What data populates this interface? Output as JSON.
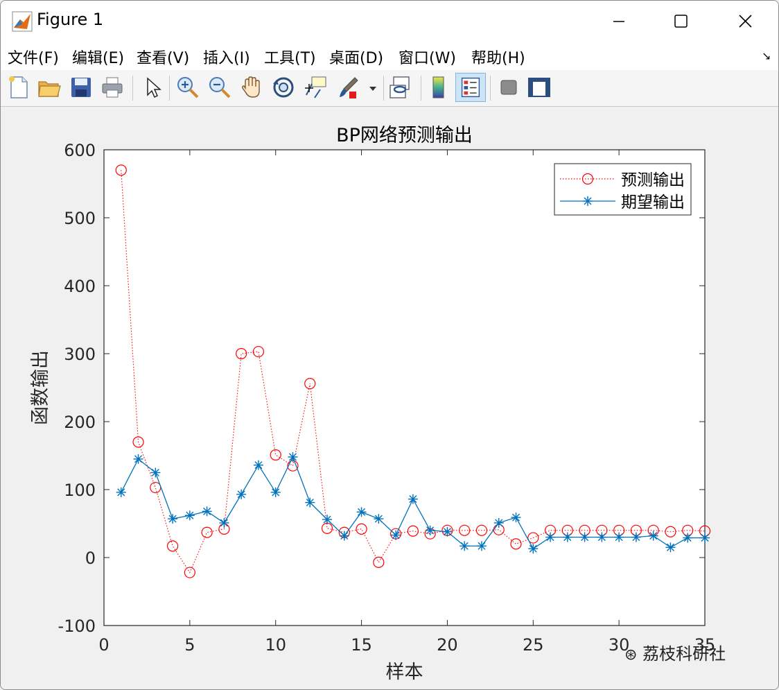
{
  "window": {
    "title": "Figure 1"
  },
  "menu": {
    "items": [
      "文件(F)",
      "编辑(E)",
      "查看(V)",
      "插入(I)",
      "工具(T)",
      "桌面(D)",
      "窗口(W)",
      "帮助(H)"
    ]
  },
  "toolbar": {
    "icons": [
      "new-figure-icon",
      "open-icon",
      "save-icon",
      "print-icon",
      "pointer-icon",
      "zoom-in-icon",
      "zoom-out-icon",
      "pan-hand-icon",
      "rotate-3d-icon",
      "data-cursor-icon",
      "brush-icon",
      "dropdown-arrow-icon",
      "link-plot-icon",
      "colorbar-icon",
      "legend-icon",
      "hide-plot-tools-icon",
      "show-plot-tools-icon"
    ]
  },
  "watermark": "荔枝科研社",
  "chart_data": {
    "type": "line",
    "title": "BP网络预测输出",
    "xlabel": "样本",
    "ylabel": "函数输出",
    "xlim": [
      0,
      35
    ],
    "ylim": [
      -100,
      600
    ],
    "xticks": [
      0,
      5,
      10,
      15,
      20,
      25,
      30,
      35
    ],
    "yticks": [
      -100,
      0,
      100,
      200,
      300,
      400,
      500,
      600
    ],
    "x": [
      1,
      2,
      3,
      4,
      5,
      6,
      7,
      8,
      9,
      10,
      11,
      12,
      13,
      14,
      15,
      16,
      17,
      18,
      19,
      20,
      21,
      22,
      23,
      24,
      25,
      26,
      27,
      28,
      29,
      30,
      31,
      32,
      33,
      34,
      35
    ],
    "series": [
      {
        "name": "预测输出",
        "color": "#ff0000",
        "marker": "circle",
        "line": "dotted",
        "values": [
          570,
          170,
          103,
          17,
          -22,
          37,
          42,
          300,
          303,
          151,
          135,
          256,
          43,
          37,
          42,
          -7,
          35,
          39,
          35,
          40,
          40,
          40,
          41,
          20,
          29,
          40,
          40,
          40,
          40,
          40,
          40,
          40,
          38,
          40,
          39
        ]
      },
      {
        "name": "期望输出",
        "color": "#0072bd",
        "marker": "asterisk",
        "line": "solid",
        "values": [
          96,
          145,
          125,
          57,
          62,
          68,
          51,
          93,
          136,
          96,
          148,
          81,
          56,
          32,
          67,
          57,
          33,
          86,
          40,
          38,
          17,
          17,
          51,
          59,
          13,
          30,
          30,
          30,
          30,
          30,
          30,
          32,
          15,
          29,
          29
        ]
      }
    ],
    "legend": "top-right"
  }
}
